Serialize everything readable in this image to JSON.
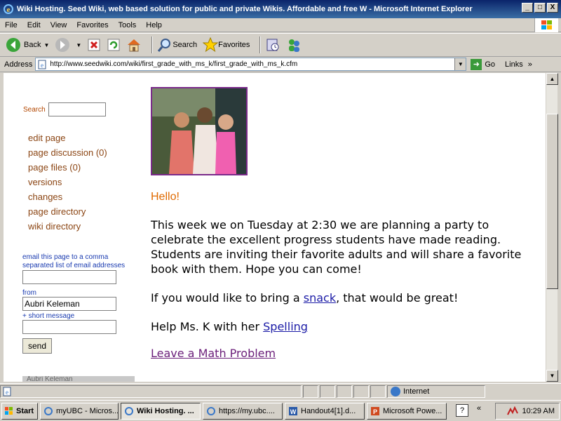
{
  "window": {
    "title": "Wiki Hosting. Seed Wiki, web based solution for public and private Wikis. Affordable and free W - Microsoft Internet Explorer",
    "buttons": {
      "minimize": "_",
      "maximize": "□",
      "close": "X"
    }
  },
  "menubar": {
    "items": [
      "File",
      "Edit",
      "View",
      "Favorites",
      "Tools",
      "Help"
    ]
  },
  "toolbar": {
    "back_label": "Back",
    "search_label": "Search",
    "favorites_label": "Favorites"
  },
  "addressbar": {
    "label": "Address",
    "url": "http://www.seedwiki.com/wiki/first_grade_with_ms_k/first_grade_with_ms_k.cfm",
    "go_label": "Go",
    "links_label": "Links"
  },
  "sidebar": {
    "search_label": "Search",
    "nav": [
      "edit page",
      "page discussion (0)",
      "page files (0)",
      "versions",
      "changes",
      "page directory",
      "wiki directory"
    ],
    "email_label": "email this page to a comma separated list of email addresses",
    "from_label": "from",
    "from_value": "Aubri Keleman",
    "message_label": "+ short message",
    "send_label": "send",
    "user_bar": "Aubri Keleman"
  },
  "main": {
    "greeting": "Hello!",
    "paragraph1": "This week we on Tuesday at 2:30 we are planning a party to celebrate the excellent progress students have made reading.  Students are inviting their favorite adults and will share a favorite book with them.  Hope you can come!",
    "p2_before": "If you would like to bring a ",
    "p2_link": "snack",
    "p2_after": ", that would be great!",
    "p3_before": "Help Ms. K with her ",
    "p3_link": "Spelling",
    "math_link": "Leave a Math Problem"
  },
  "statusbar": {
    "zone": "Internet"
  },
  "taskbar": {
    "start": "Start",
    "tasks": [
      "myUBC - Micros...",
      "Wiki Hosting. ...",
      "https://my.ubc....",
      "Handout4[1].d...",
      "Microsoft Powe..."
    ],
    "active_index": 1,
    "help": "?",
    "chevron": "«",
    "clock": "10:29 AM"
  },
  "colors": {
    "titlebar": "#0a246a",
    "nav_link": "#8b4513",
    "email_label": "#1a3bb0",
    "greeting": "#e06a00",
    "photo_border": "#7a2a8a"
  }
}
